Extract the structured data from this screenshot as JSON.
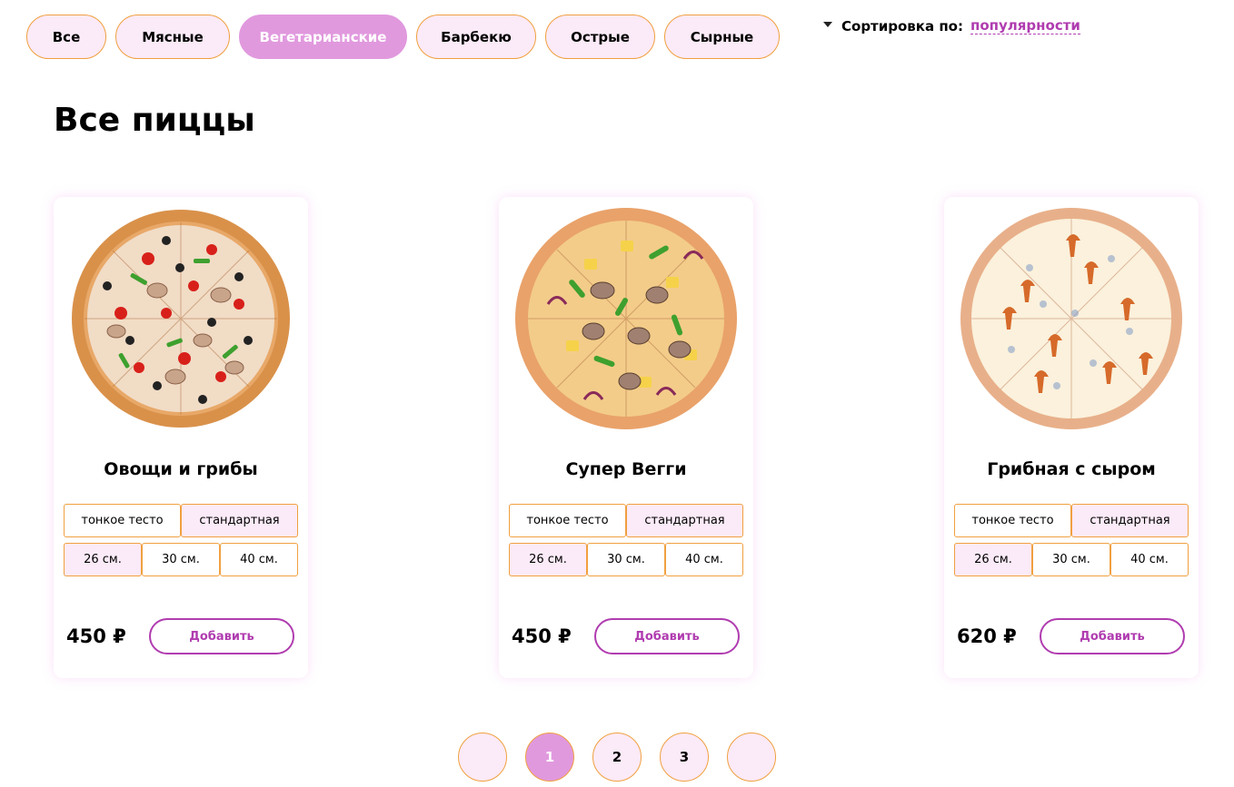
{
  "categories": [
    {
      "label": "Все",
      "active": false
    },
    {
      "label": "Мясные",
      "active": false
    },
    {
      "label": "Вегетарианские",
      "active": true
    },
    {
      "label": "Барбекю",
      "active": false
    },
    {
      "label": "Острые",
      "active": false
    },
    {
      "label": "Сырные",
      "active": false
    }
  ],
  "sort": {
    "label": "Сортировка по:",
    "value": "популярности"
  },
  "page_title": "Все пиццы",
  "products": [
    {
      "name": "Овощи и грибы",
      "dough": [
        "тонкое тесто",
        "стандартная"
      ],
      "dough_selected": 1,
      "sizes": [
        "26 см.",
        "30 см.",
        "40 см."
      ],
      "size_selected": 0,
      "price": "450 ₽",
      "add_label": "Добавить",
      "image_icon": "pizza-veggies-mushrooms-image"
    },
    {
      "name": "Супер Вегги",
      "dough": [
        "тонкое тесто",
        "стандартная"
      ],
      "dough_selected": 1,
      "sizes": [
        "26 см.",
        "30 см.",
        "40 см."
      ],
      "size_selected": 0,
      "price": "450 ₽",
      "add_label": "Добавить",
      "image_icon": "pizza-super-veggie-image"
    },
    {
      "name": "Грибная с сыром",
      "dough": [
        "тонкое тесто",
        "стандартная"
      ],
      "dough_selected": 1,
      "sizes": [
        "26 см.",
        "30 см.",
        "40 см."
      ],
      "size_selected": 0,
      "price": "620 ₽",
      "add_label": "Добавить",
      "image_icon": "pizza-mushroom-cheese-image"
    }
  ],
  "pagination": {
    "pages": [
      "1",
      "2",
      "3"
    ],
    "current": "1",
    "prev_icon": "prev-page-icon",
    "next_icon": "next-page-icon"
  },
  "colors": {
    "accent": "#e199de",
    "accent_text": "#b03cb0",
    "chip_bg": "#fbeaf7",
    "border": "#f0a040"
  }
}
